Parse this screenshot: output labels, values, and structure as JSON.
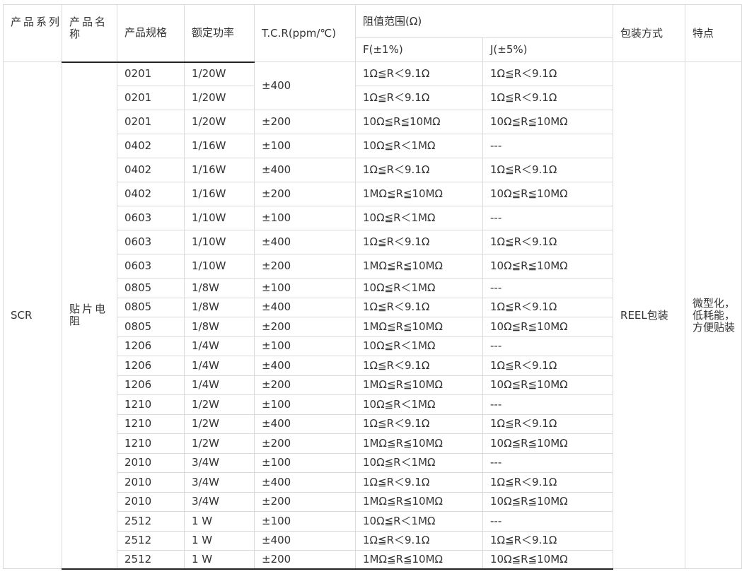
{
  "table": {
    "headers": {
      "series": "产品系列",
      "name": "产品名称",
      "spec": "产品规格",
      "power": "额定功率",
      "tcr": "T.C.R(ppm/℃)",
      "range": "阻值范围(Ω)",
      "range_f": "F(±1%)",
      "range_j": "J(±5%)",
      "package": "包装方式",
      "feature": "特点"
    },
    "series": "SCR",
    "name": "贴片电阻",
    "package": "REEL包装",
    "feature": "微型化，低耗能，方便贴装",
    "rows": [
      {
        "spec": "0201",
        "power": "1/20W",
        "tcr": "±400",
        "f": "1Ω≦R＜9.1Ω",
        "j": "1Ω≦R＜9.1Ω"
      },
      {
        "spec": "0201",
        "power": "1/20W",
        "tcr": "",
        "f": "1Ω≦R＜9.1Ω",
        "j": "1Ω≦R＜9.1Ω"
      },
      {
        "spec": "0201",
        "power": "1/20W",
        "tcr": "±200",
        "f": "10Ω≦R≦10MΩ",
        "j": "10Ω≦R≦10MΩ"
      },
      {
        "spec": "0402",
        "power": "1/16W",
        "tcr": "±100",
        "f": "10Ω≦R＜1MΩ",
        "j": "---"
      },
      {
        "spec": "0402",
        "power": "1/16W",
        "tcr": "±400",
        "f": "1Ω≦R＜9.1Ω",
        "j": "1Ω≦R＜9.1Ω"
      },
      {
        "spec": "0402",
        "power": "1/16W",
        "tcr": "±200",
        "f": "1MΩ≦R≦10MΩ",
        "j": "10Ω≦R≦10MΩ"
      },
      {
        "spec": "0603",
        "power": "1/10W",
        "tcr": "±100",
        "f": "10Ω≦R＜1MΩ",
        "j": "---"
      },
      {
        "spec": "0603",
        "power": "1/10W",
        "tcr": "±400",
        "f": "1Ω≦R＜9.1Ω",
        "j": "1Ω≦R＜9.1Ω"
      },
      {
        "spec": "0603",
        "power": "1/10W",
        "tcr": "±200",
        "f": "1MΩ≦R≦10MΩ",
        "j": "10Ω≦R≦10MΩ"
      },
      {
        "spec": "0805",
        "power": "1/8W",
        "tcr": "±100",
        "f": "10Ω≦R＜1MΩ",
        "j": "---"
      },
      {
        "spec": "0805",
        "power": "1/8W",
        "tcr": "±400",
        "f": "1Ω≦R＜9.1Ω",
        "j": "1Ω≦R＜9.1Ω"
      },
      {
        "spec": "0805",
        "power": "1/8W",
        "tcr": "±200",
        "f": "1MΩ≦R≦10MΩ",
        "j": "10Ω≦R≦10MΩ"
      },
      {
        "spec": "1206",
        "power": "1/4W",
        "tcr": "±100",
        "f": "10Ω≦R＜1MΩ",
        "j": "---"
      },
      {
        "spec": "1206",
        "power": "1/4W",
        "tcr": "±400",
        "f": "1Ω≦R＜9.1Ω",
        "j": "1Ω≦R＜9.1Ω"
      },
      {
        "spec": "1206",
        "power": "1/4W",
        "tcr": "±200",
        "f": "1MΩ≦R≦10MΩ",
        "j": "10Ω≦R≦10MΩ"
      },
      {
        "spec": "1210",
        "power": "1/2W",
        "tcr": "±100",
        "f": "10Ω≦R＜1MΩ",
        "j": "---"
      },
      {
        "spec": "1210",
        "power": "1/2W",
        "tcr": "±400",
        "f": "1Ω≦R＜9.1Ω",
        "j": "1Ω≦R＜9.1Ω"
      },
      {
        "spec": "1210",
        "power": "1/2W",
        "tcr": "±200",
        "f": "1MΩ≦R≦10MΩ",
        "j": "10Ω≦R≦10MΩ"
      },
      {
        "spec": "2010",
        "power": "3/4W",
        "tcr": "±100",
        "f": "10Ω≦R＜1MΩ",
        "j": "---"
      },
      {
        "spec": "2010",
        "power": "3/4W",
        "tcr": "±400",
        "f": "1Ω≦R＜9.1Ω",
        "j": "1Ω≦R＜9.1Ω"
      },
      {
        "spec": "2010",
        "power": "3/4W",
        "tcr": "±200",
        "f": "1MΩ≦R≦10MΩ",
        "j": "10Ω≦R≦10MΩ"
      },
      {
        "spec": "2512",
        "power": "1 W",
        "tcr": "±100",
        "f": "10Ω≦R＜1MΩ",
        "j": "---"
      },
      {
        "spec": "2512",
        "power": "1 W",
        "tcr": "±400",
        "f": "1Ω≦R＜9.1Ω",
        "j": "1Ω≦R＜9.1Ω"
      },
      {
        "spec": "2512",
        "power": "1 W",
        "tcr": "±200",
        "f": "1MΩ≦R≦10MΩ",
        "j": "10Ω≦R≦10MΩ"
      }
    ]
  }
}
